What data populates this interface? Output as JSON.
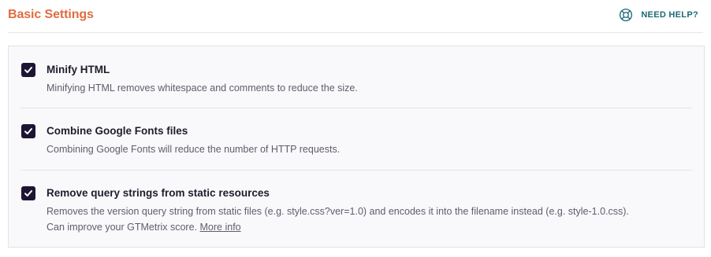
{
  "header": {
    "title": "Basic Settings",
    "help_label": "NEED HELP?"
  },
  "options": [
    {
      "title": "Minify HTML",
      "description": "Minifying HTML removes whitespace and comments to reduce the size.",
      "checked": true
    },
    {
      "title": "Combine Google Fonts files",
      "description": "Combining Google Fonts will reduce the number of HTTP requests.",
      "checked": true
    },
    {
      "title": "Remove query strings from static resources",
      "description_line1": "Removes the version query string from static files (e.g. style.css?ver=1.0) and encodes it into the filename instead (e.g. style-1.0.css).",
      "description_line2": "Can improve your GTMetrix score.",
      "more_info_link": "More info",
      "checked": true
    }
  ],
  "colors": {
    "title_accent": "#e06d3f",
    "help_accent": "#1c6b77",
    "checkbox_fill": "#1e1433"
  },
  "icons": {
    "help": "lifebuoy-icon",
    "check": "checkmark-icon"
  }
}
